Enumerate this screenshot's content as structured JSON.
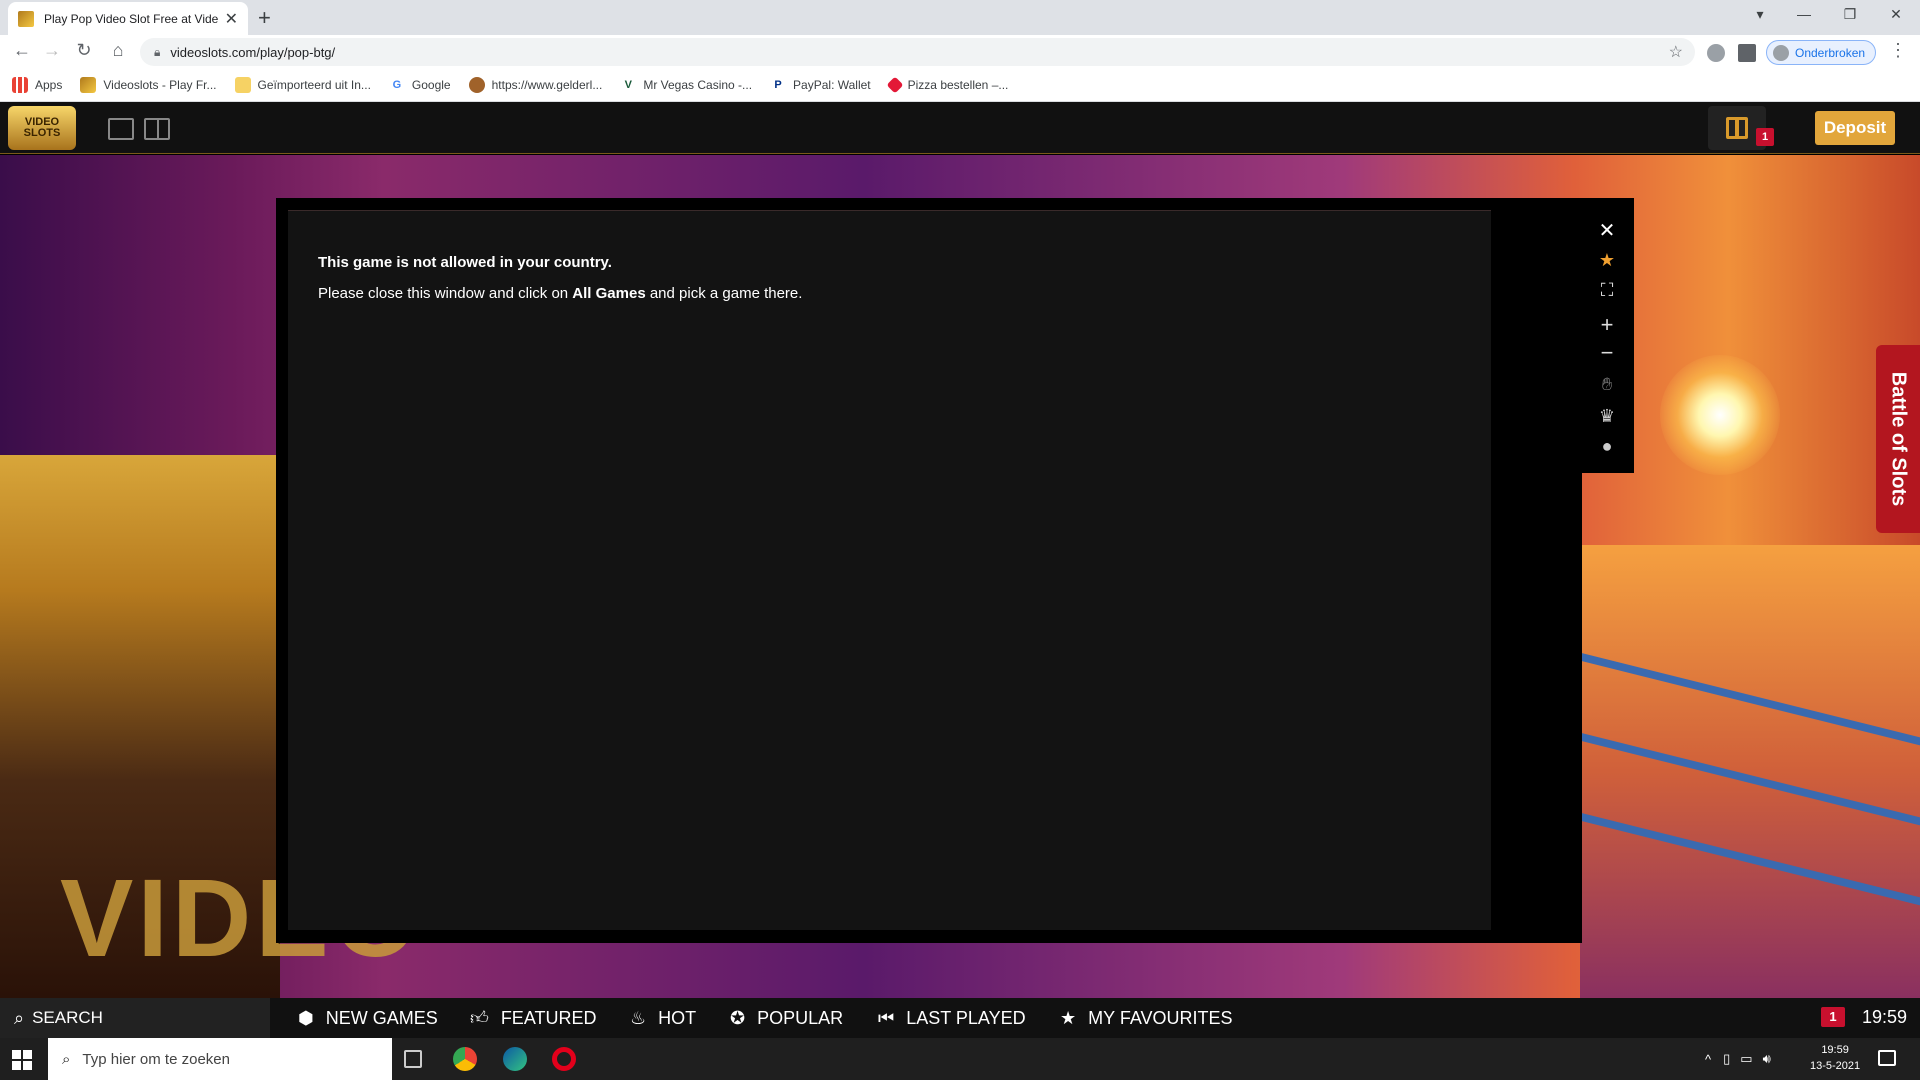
{
  "browser": {
    "tab_title": "Play Pop Video Slot Free at Vide",
    "url": "videoslots.com/play/pop-btg/",
    "profile_label": "Onderbroken",
    "bookmarks": [
      {
        "label": "Apps",
        "icon": "apps-grid-icon"
      },
      {
        "label": "Videoslots - Play Fr...",
        "icon": "videoslots-icon"
      },
      {
        "label": "Geïmporteerd uit In...",
        "icon": "folder-icon"
      },
      {
        "label": "Google",
        "icon": "google-icon"
      },
      {
        "label": "https://www.gelderl...",
        "icon": "site-icon"
      },
      {
        "label": "Mr Vegas Casino -...",
        "icon": "mrvegas-icon"
      },
      {
        "label": "PayPal: Wallet",
        "icon": "paypal-icon"
      },
      {
        "label": "Pizza bestellen –...",
        "icon": "dominos-icon"
      }
    ]
  },
  "site": {
    "deposit_label": "Deposit",
    "gift_count": "1",
    "logo_text": "VIDEO SLOTS"
  },
  "game": {
    "message_title": "This game is not allowed in your country.",
    "message_prefix": "Please close this window and click on ",
    "message_link": "All Games",
    "message_suffix": " and pick a game there.",
    "sidebar_icons": [
      "close-icon",
      "favourite-star-icon",
      "fullscreen-icon",
      "zoom-in-icon",
      "zoom-out-icon",
      "hand-icon",
      "trophy-icon",
      "chat-icon"
    ]
  },
  "battle_tab": "Battle of Slots",
  "gamebar": {
    "search_label": "SEARCH",
    "categories": [
      {
        "label": "NEW GAMES",
        "icon": "new-games-icon"
      },
      {
        "label": "FEATURED",
        "icon": "thumbs-up-icon"
      },
      {
        "label": "HOT",
        "icon": "flame-icon"
      },
      {
        "label": "POPULAR",
        "icon": "popular-icon"
      },
      {
        "label": "LAST PLAYED",
        "icon": "last-played-icon"
      },
      {
        "label": "MY FAVOURITES",
        "icon": "star-icon"
      }
    ],
    "notification_count": "1",
    "clock": "19:59"
  },
  "taskbar": {
    "search_placeholder": "Typ hier om te zoeken",
    "time": "19:59",
    "date": "13-5-2021"
  },
  "colors": {
    "deposit": "#e2a63b",
    "badge_red": "#c8102e",
    "battle_red": "#b3161f"
  }
}
